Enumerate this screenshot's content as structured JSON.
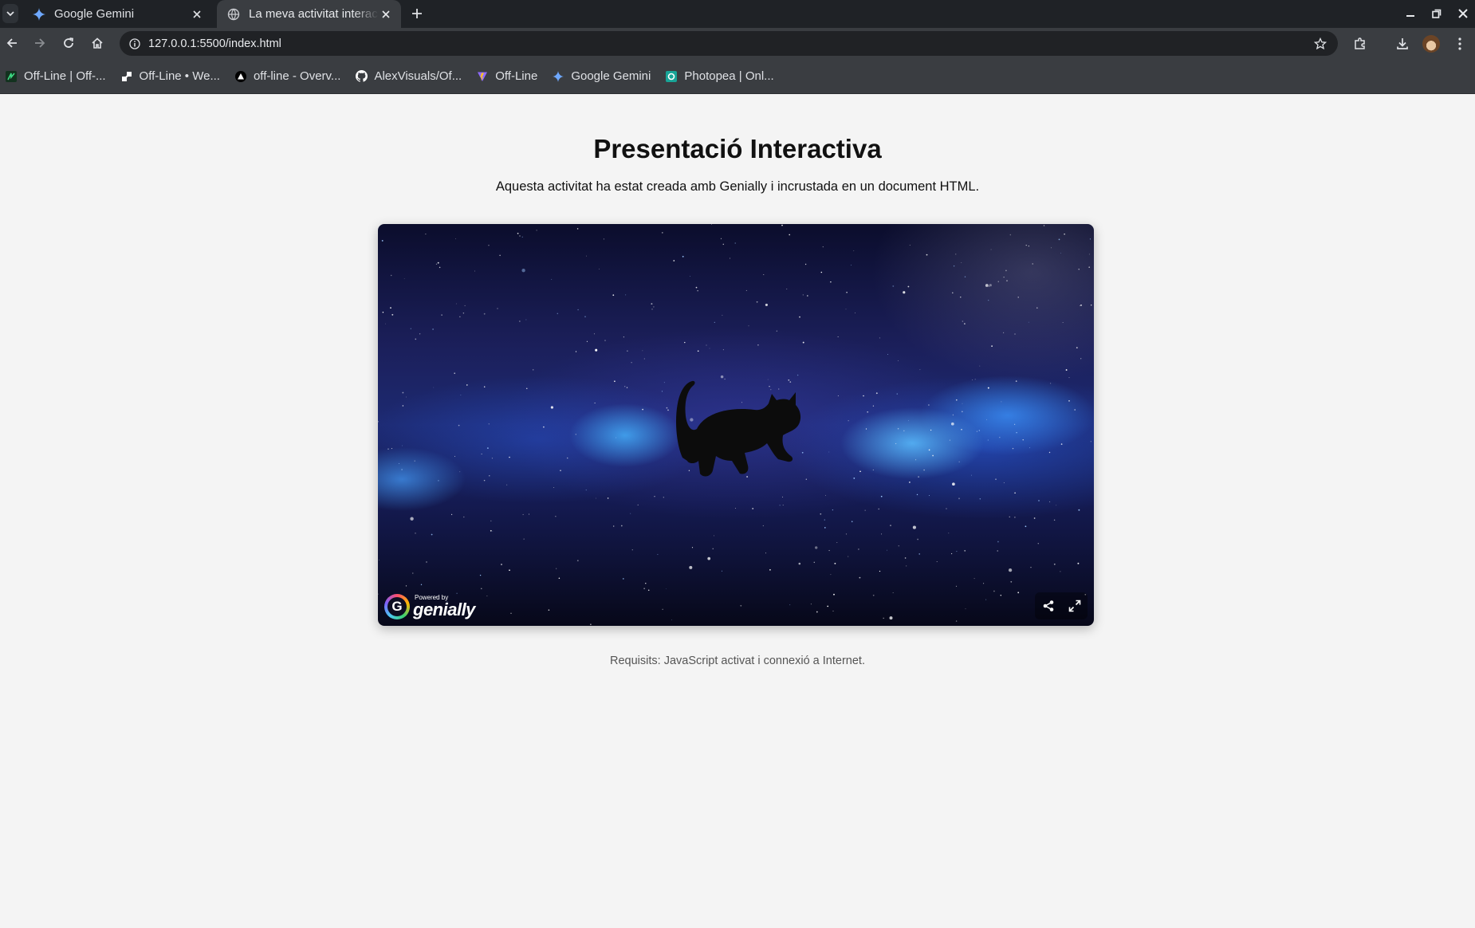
{
  "browser": {
    "tabs": [
      {
        "title": "Google Gemini",
        "active": false
      },
      {
        "title": "La meva activitat interactiva",
        "active": true
      }
    ],
    "url": "127.0.0.1:5500/index.html",
    "bookmarks": [
      {
        "label": "Off-Line | Off-...",
        "icon": "offline-leaf-icon"
      },
      {
        "label": "Off-Line • We...",
        "icon": "link-icon"
      },
      {
        "label": "off-line - Overv...",
        "icon": "vercel-triangle-icon"
      },
      {
        "label": "AlexVisuals/Of...",
        "icon": "github-icon"
      },
      {
        "label": "Off-Line",
        "icon": "vite-icon"
      },
      {
        "label": "Google Gemini",
        "icon": "gemini-icon"
      },
      {
        "label": "Photopea | Onl...",
        "icon": "photopea-icon"
      }
    ]
  },
  "page": {
    "title": "Presentació Interactiva",
    "subtitle": "Aquesta activitat ha estat creada amb Genially i incrustada en un document HTML.",
    "requirements": "Requisits: JavaScript activat i connexió a Internet."
  },
  "embed": {
    "logo_powered": "Powered by",
    "logo_name": "genially",
    "logo_letter": "G"
  },
  "colors": {
    "chrome_dark": "#1f2226",
    "chrome": "#3a3d41",
    "page_bg": "#f4f4f4"
  }
}
